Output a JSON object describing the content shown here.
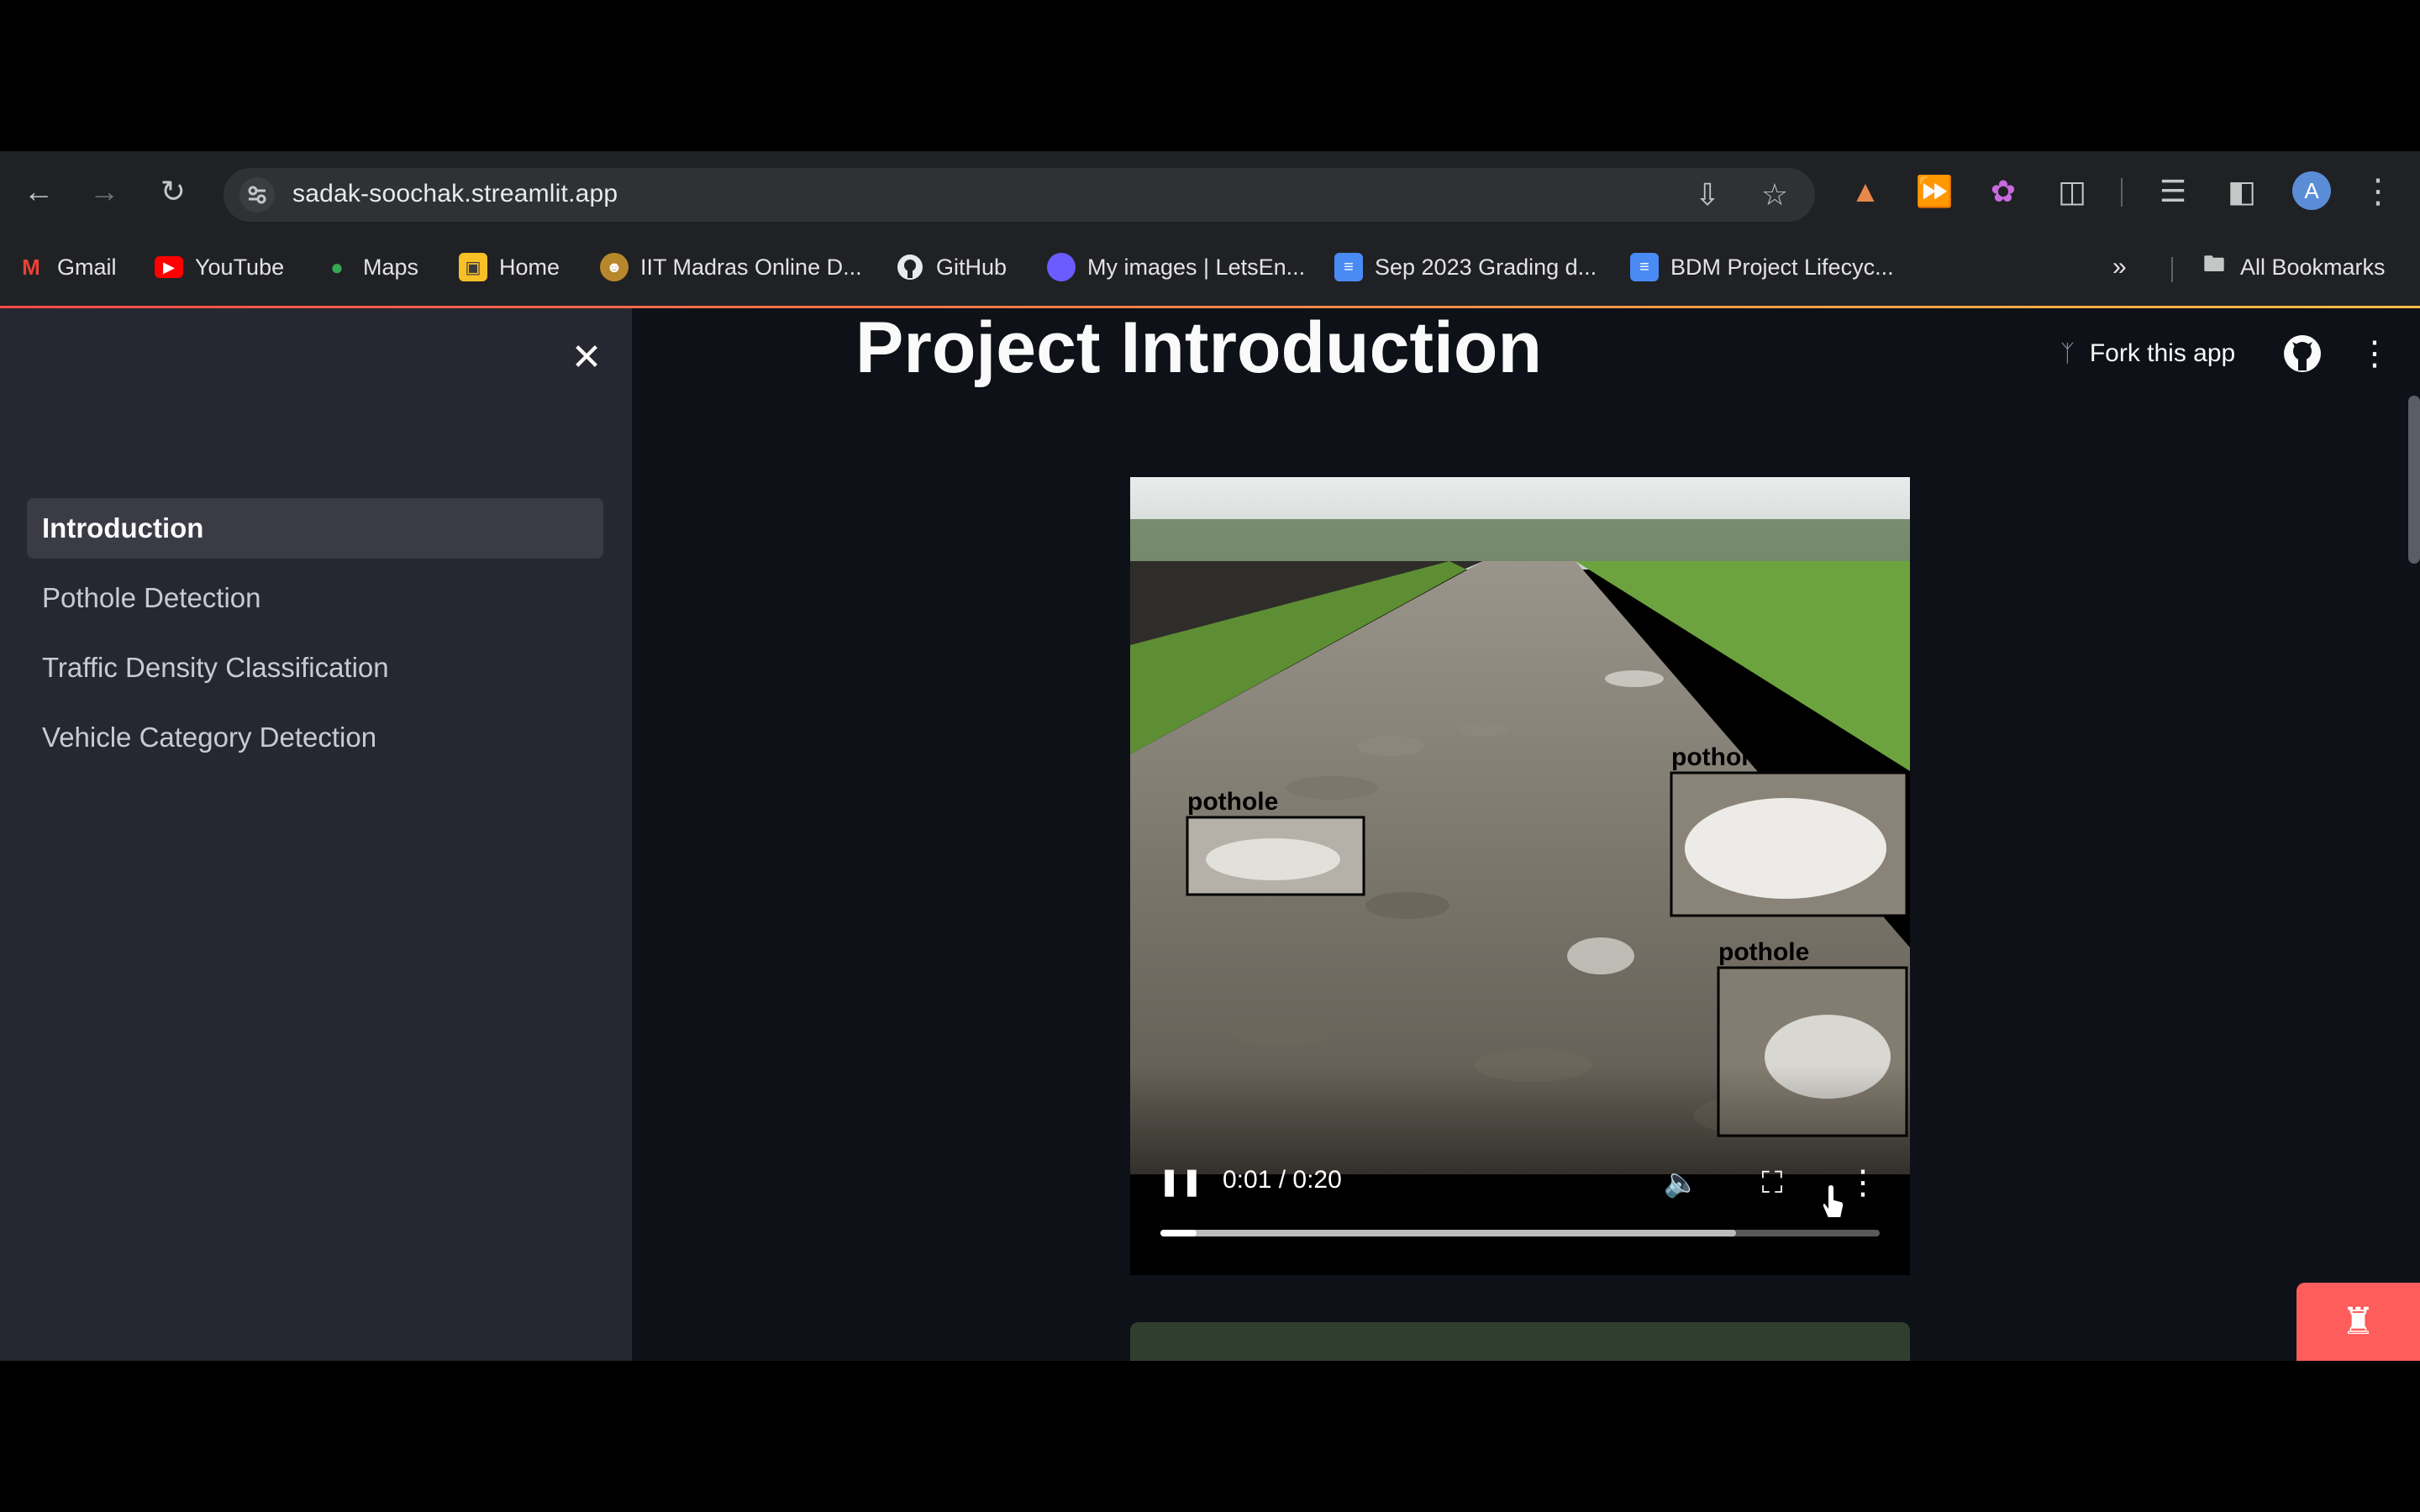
{
  "browser": {
    "url": "sadak-soochak.streamlit.app",
    "profile_initial": "A",
    "bookmarks": [
      {
        "label": "Gmail",
        "icon": "gmail-icon"
      },
      {
        "label": "YouTube",
        "icon": "youtube-icon"
      },
      {
        "label": "Maps",
        "icon": "maps-icon"
      },
      {
        "label": "Home",
        "icon": "home-icon"
      },
      {
        "label": "IIT Madras Online D...",
        "icon": "iitm-icon"
      },
      {
        "label": "GitHub",
        "icon": "github-icon"
      },
      {
        "label": "My images | LetsEn...",
        "icon": "letsenhance-icon"
      },
      {
        "label": "Sep 2023 Grading d...",
        "icon": "docs-icon"
      },
      {
        "label": "BDM Project Lifecyc...",
        "icon": "docs-icon"
      }
    ],
    "all_bookmarks_label": "All Bookmarks",
    "accent_colors": {
      "tab_line_start": "#ff4b4b",
      "tab_line_end": "#ffbd45"
    }
  },
  "sidebar": {
    "items": [
      {
        "label": "Introduction",
        "active": true
      },
      {
        "label": "Pothole Detection",
        "active": false
      },
      {
        "label": "Traffic Density Classification",
        "active": false
      },
      {
        "label": "Vehicle Category Detection",
        "active": false
      }
    ]
  },
  "header": {
    "fork_label": "Fork this app"
  },
  "main": {
    "title": "Project Introduction",
    "video": {
      "time": "0:01 / 0:20",
      "played_fraction": 0.05,
      "buffered_fraction": 0.8,
      "detections": [
        "pothole",
        "pothole",
        "pothole"
      ]
    }
  },
  "colors": {
    "app_background": "#0e1117",
    "sidebar_background": "#262730",
    "badge": "#ff5c5c"
  }
}
